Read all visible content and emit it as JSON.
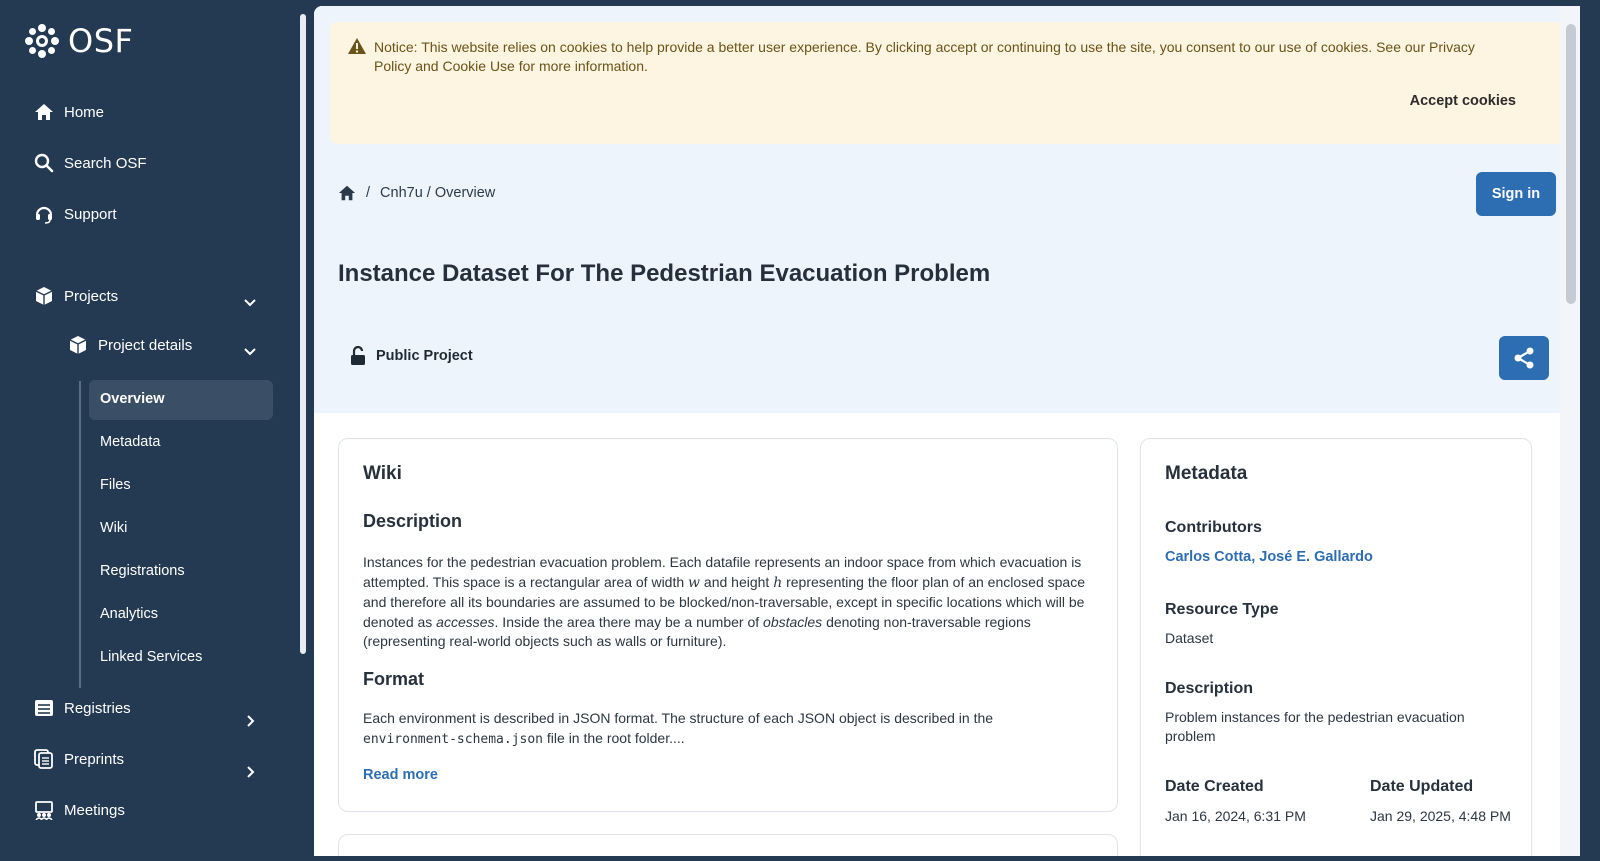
{
  "brand": {
    "name": "OSF"
  },
  "nav": {
    "home": "Home",
    "search": "Search OSF",
    "support": "Support",
    "projects": "Projects",
    "project_details": "Project details",
    "sub_items": [
      "Overview",
      "Metadata",
      "Files",
      "Wiki",
      "Registrations",
      "Analytics",
      "Linked Services"
    ],
    "registries": "Registries",
    "preprints": "Preprints",
    "meetings": "Meetings"
  },
  "cookie": {
    "text": "Notice: This website relies on cookies to help provide a better user experience. By clicking accept or continuing to use the site, you consent to our use of cookies. See our Privacy Policy and Cookie Use for more information.",
    "accept": "Accept cookies"
  },
  "breadcrumb": {
    "separator": "/",
    "path": "Cnh7u / Overview"
  },
  "signin": "Sign in",
  "title": "Instance Dataset For The Pedestrian Evacuation Problem",
  "visibility": "Public Project",
  "wiki": {
    "heading": "Wiki",
    "description_heading": "Description",
    "description_parts": {
      "p1": "Instances for the pedestrian evacuation problem. Each datafile represents an indoor space from which evacuation is attempted. This space is a rectangular area of width ",
      "w": "w",
      "p2": " and height ",
      "h": "h",
      "p3": " representing the floor plan of an enclosed space and therefore all its boundaries are assumed to be blocked/non-traversable, except in specific locations which will be denoted as ",
      "accesses": "accesses",
      "p4": ". Inside the area there may be a number of ",
      "obstacles": "obstacles",
      "p5": " denoting non-traversable regions (representing real-world objects such as walls or furniture)."
    },
    "format_heading": "Format",
    "format_parts": {
      "p1": "Each environment is described in JSON format. The structure of each JSON object is described in the",
      "code": "environment-schema.json",
      "p2": " file in the root folder...."
    },
    "read_more": "Read more"
  },
  "metadata": {
    "heading": "Metadata",
    "contributors_label": "Contributors",
    "contributors": "Carlos Cotta, José E. Gallardo",
    "resource_type_label": "Resource Type",
    "resource_type": "Dataset",
    "description_label": "Description",
    "description": "Problem instances for the pedestrian evacuation problem",
    "date_created_label": "Date Created",
    "date_created": "Jan 16, 2024, 6:31 PM",
    "date_updated_label": "Date Updated",
    "date_updated": "Jan 29, 2025, 4:48 PM"
  },
  "colors": {
    "sidebar": "#243a52",
    "primary": "#2d6db2",
    "hero": "#eef4fb",
    "notice": "#fdf5e1"
  }
}
